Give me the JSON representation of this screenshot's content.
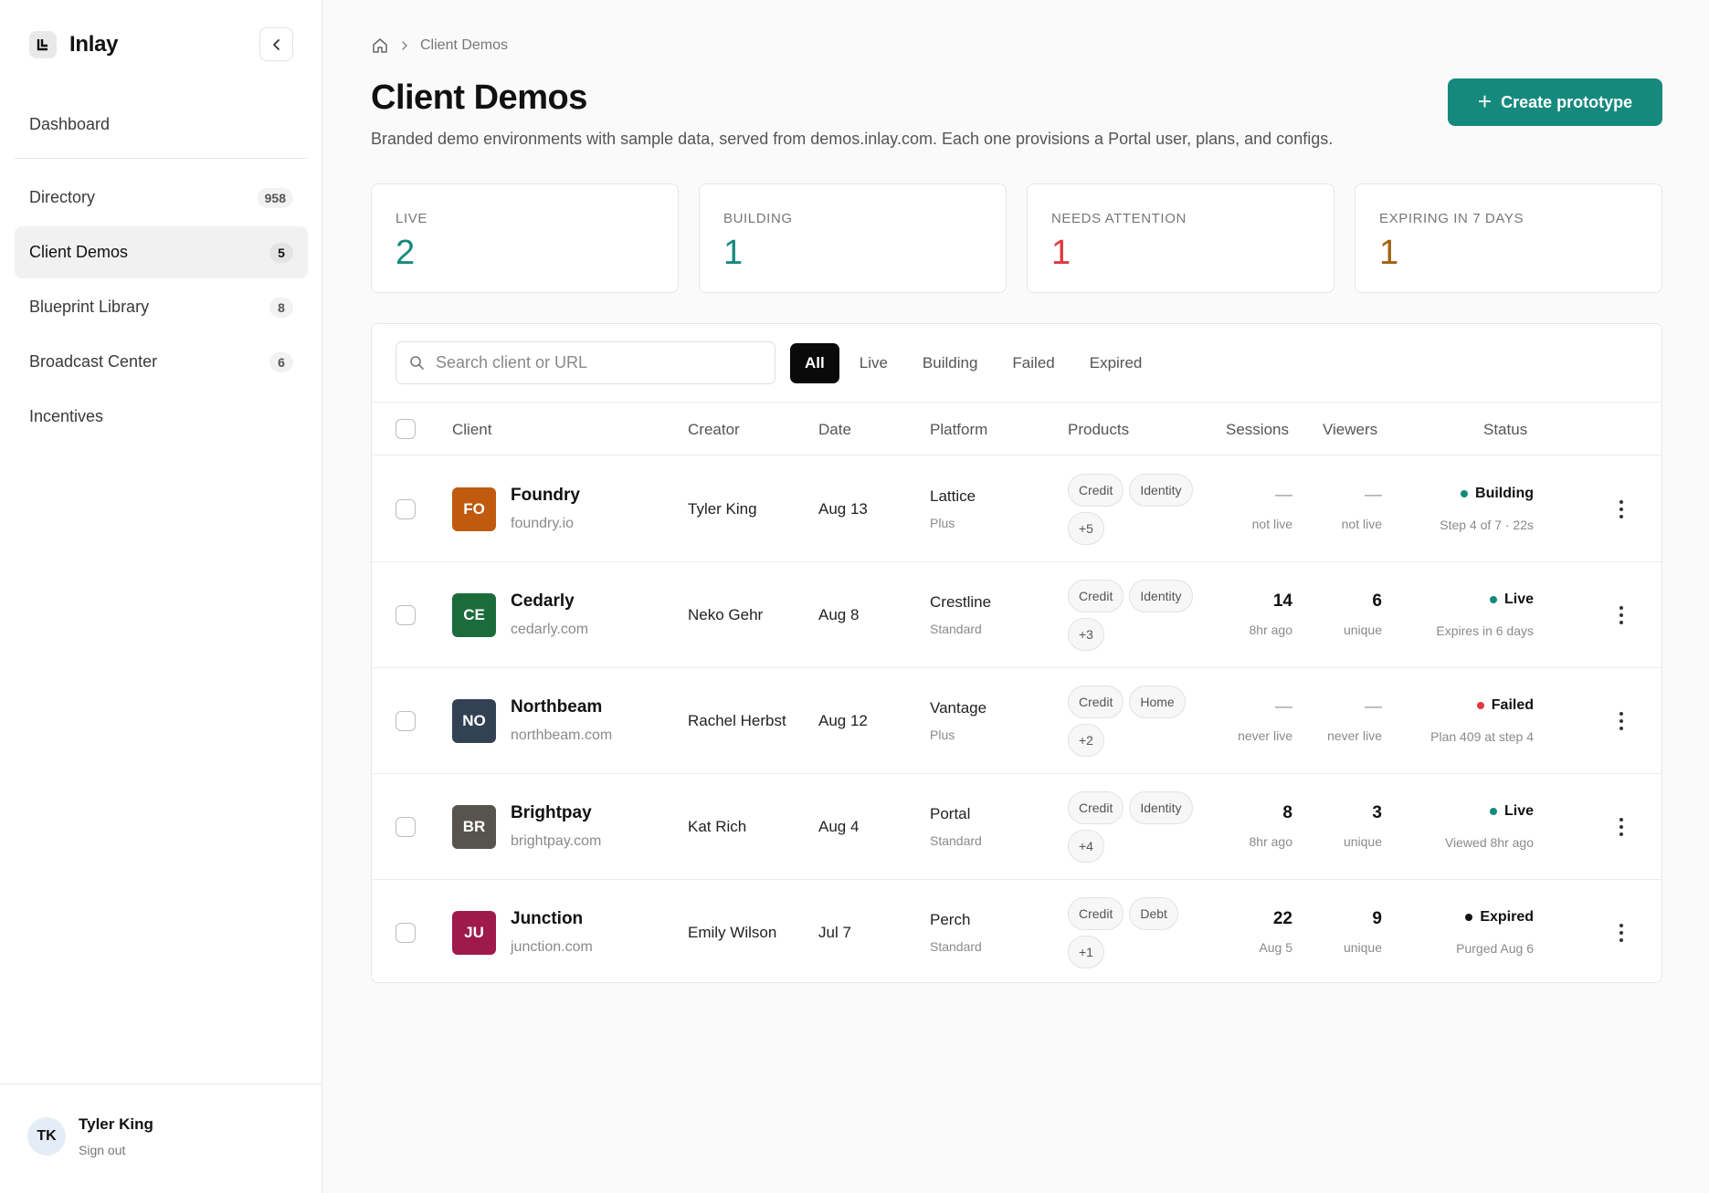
{
  "app": {
    "name": "Inlay"
  },
  "sidebar": {
    "dashboard": "Dashboard",
    "items": [
      {
        "label": "Directory",
        "count": "958",
        "active": false
      },
      {
        "label": "Client Demos",
        "count": "5",
        "active": true
      },
      {
        "label": "Blueprint Library",
        "count": "8",
        "active": false
      },
      {
        "label": "Broadcast Center",
        "count": "6",
        "active": false
      },
      {
        "label": "Incentives",
        "count": "",
        "active": false
      }
    ],
    "user": {
      "initials": "TK",
      "name": "Tyler King",
      "signout": "Sign out"
    }
  },
  "breadcrumb": {
    "current": "Client Demos"
  },
  "page": {
    "title": "Client Demos",
    "description": "Branded demo environments with sample data, served from demos.inlay.com. Each one provisions a Portal user, plans, and configs.",
    "create_button": "Create prototype"
  },
  "stats": [
    {
      "label": "LIVE",
      "value": "2",
      "color": "#16897d"
    },
    {
      "label": "BUILDING",
      "value": "1",
      "color": "#16897d"
    },
    {
      "label": "NEEDS ATTENTION",
      "value": "1",
      "color": "#e0383e"
    },
    {
      "label": "EXPIRING IN 7 DAYS",
      "value": "1",
      "color": "#a0620c"
    }
  ],
  "search": {
    "placeholder": "Search client or URL"
  },
  "filters": [
    "All",
    "Live",
    "Building",
    "Failed",
    "Expired"
  ],
  "columns": {
    "client": "Client",
    "creator": "Creator",
    "date": "Date",
    "platform": "Platform",
    "products": "Products",
    "sessions": "Sessions",
    "viewers": "Viewers",
    "status": "Status"
  },
  "rows": [
    {
      "initials": "FO",
      "color": "#bf5a0f",
      "name": "Foundry",
      "url": "foundry.io",
      "creator": "Tyler King",
      "date": "Aug 13",
      "platform": "Lattice",
      "tier": "Plus",
      "products": [
        "Credit",
        "Identity",
        "+5"
      ],
      "sessions": "—",
      "sessions_sub": "not live",
      "viewers": "—",
      "viewers_sub": "not live",
      "status": "Building",
      "status_color": "#16897d",
      "status_sub": "Step 4 of 7 · 22s"
    },
    {
      "initials": "CE",
      "color": "#1c6b3a",
      "name": "Cedarly",
      "url": "cedarly.com",
      "creator": "Neko Gehr",
      "date": "Aug 8",
      "platform": "Crestline",
      "tier": "Standard",
      "products": [
        "Credit",
        "Identity",
        "+3"
      ],
      "sessions": "14",
      "sessions_sub": "8hr ago",
      "viewers": "6",
      "viewers_sub": "unique",
      "status": "Live",
      "status_color": "#16897d",
      "status_sub": "Expires in 6 days"
    },
    {
      "initials": "NO",
      "color": "#334155",
      "name": "Northbeam",
      "url": "northbeam.com",
      "creator": "Rachel Herbst",
      "date": "Aug 12",
      "platform": "Vantage",
      "tier": "Plus",
      "products": [
        "Credit",
        "Home",
        "+2"
      ],
      "sessions": "—",
      "sessions_sub": "never live",
      "viewers": "—",
      "viewers_sub": "never live",
      "status": "Failed",
      "status_color": "#e0383e",
      "status_sub": "Plan 409 at step 4"
    },
    {
      "initials": "BR",
      "color": "#57534e",
      "name": "Brightpay",
      "url": "brightpay.com",
      "creator": "Kat Rich",
      "date": "Aug 4",
      "platform": "Portal",
      "tier": "Standard",
      "products": [
        "Credit",
        "Identity",
        "+4"
      ],
      "sessions": "8",
      "sessions_sub": "8hr ago",
      "viewers": "3",
      "viewers_sub": "unique",
      "status": "Live",
      "status_color": "#16897d",
      "status_sub": "Viewed 8hr ago"
    },
    {
      "initials": "JU",
      "color": "#9d1a4a",
      "name": "Junction",
      "url": "junction.com",
      "creator": "Emily Wilson",
      "date": "Jul 7",
      "platform": "Perch",
      "tier": "Standard",
      "products": [
        "Credit",
        "Debt",
        "+1"
      ],
      "sessions": "22",
      "sessions_sub": "Aug 5",
      "viewers": "9",
      "viewers_sub": "unique",
      "status": "Expired",
      "status_color": "#111111",
      "status_sub": "Purged Aug 6"
    }
  ]
}
